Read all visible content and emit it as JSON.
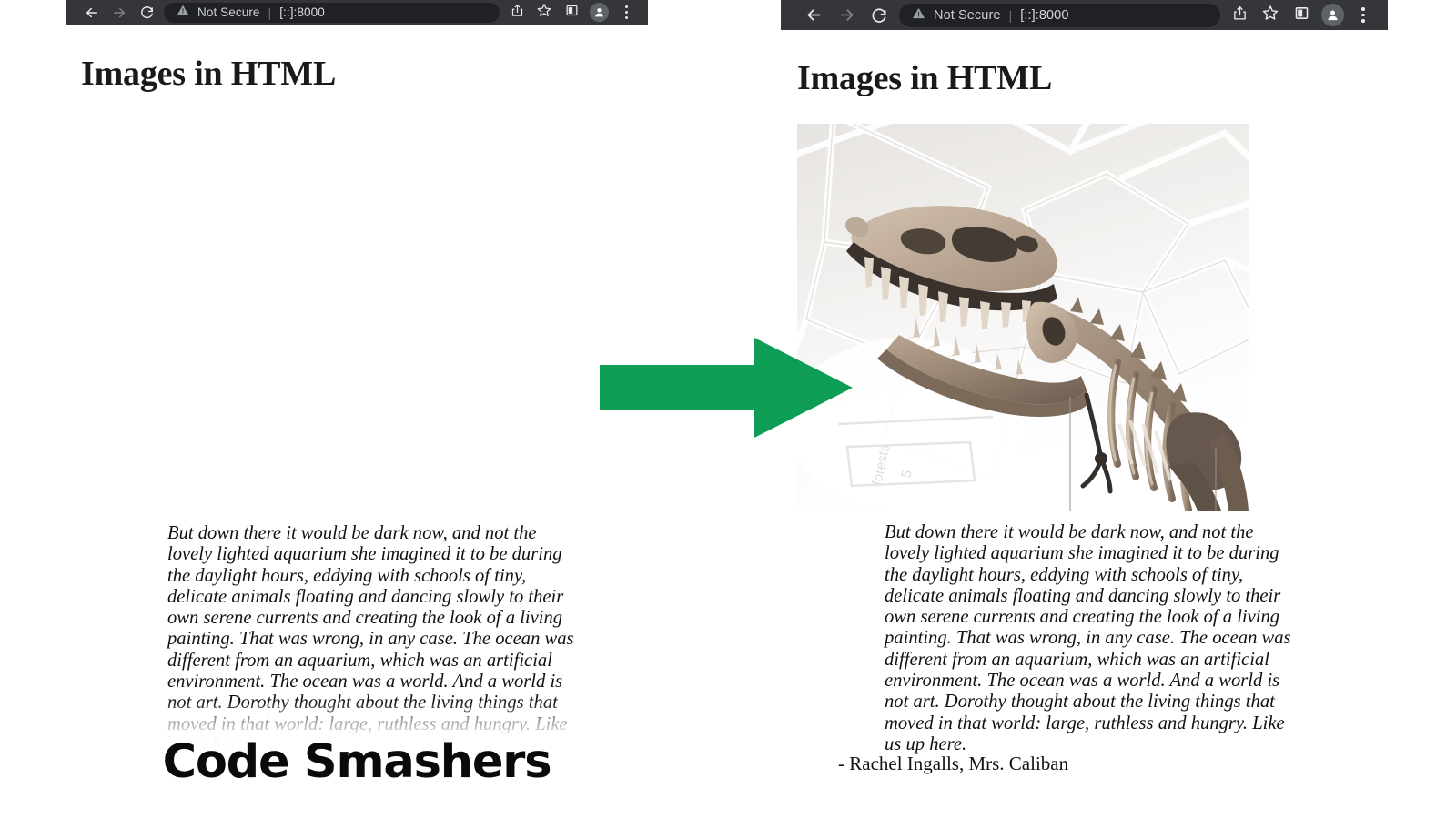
{
  "browser": {
    "back_icon": "back-arrow-icon",
    "forward_icon": "forward-arrow-icon",
    "reload_icon": "reload-icon",
    "security_label": "Not Secure",
    "security_icon": "warning-triangle-icon",
    "separator": "|",
    "url": "[::]:8000",
    "share_icon": "share-icon",
    "bookmark_icon": "star-icon",
    "side_panel_icon": "side-panel-icon",
    "profile_icon": "profile-avatar-icon",
    "menu_icon": "three-dot-menu-icon"
  },
  "left_pane": {
    "heading": "Images in HTML",
    "quote": "But down there it would be dark now, and not the lovely lighted aquarium she imagined it to be during the daylight hours, eddying with schools of tiny, delicate animals floating and dancing slowly to their own serene currents and creating the look of a living painting. That was wrong, in any case. The ocean was different from an aquarium, which was an artificial environment. The ocean was a world. And a world is not art. Dorothy thought about the living things that moved in that world: large, ruthless and hungry. Like us up here.",
    "watermark": "Code Smashers"
  },
  "right_pane": {
    "heading": "Images in HTML",
    "image_alt": "t-rex-skeleton-photo",
    "quote": "But down there it would be dark now, and not the lovely lighted aquarium she imagined it to be during the daylight hours, eddying with schools of tiny, delicate animals floating and dancing slowly to their own serene currents and creating the look of a living painting. That was wrong, in any case. The ocean was different from an aquarium, which was an artificial environment. The ocean was a world. And a world is not art. Dorothy thought about the living things that moved in that world: large, ruthless and hungry. Like us up here.",
    "attribution": "- Rachel Ingalls, Mrs. Caliban"
  },
  "annotation": {
    "arrow_icon": "right-arrow-icon",
    "arrow_color": "#0e9d54"
  },
  "colors": {
    "toolbar_bg": "#35363a",
    "omnibox_bg": "#202124",
    "page_bg": "#ffffff",
    "text": "#111111",
    "accent_green": "#0e9d54"
  }
}
